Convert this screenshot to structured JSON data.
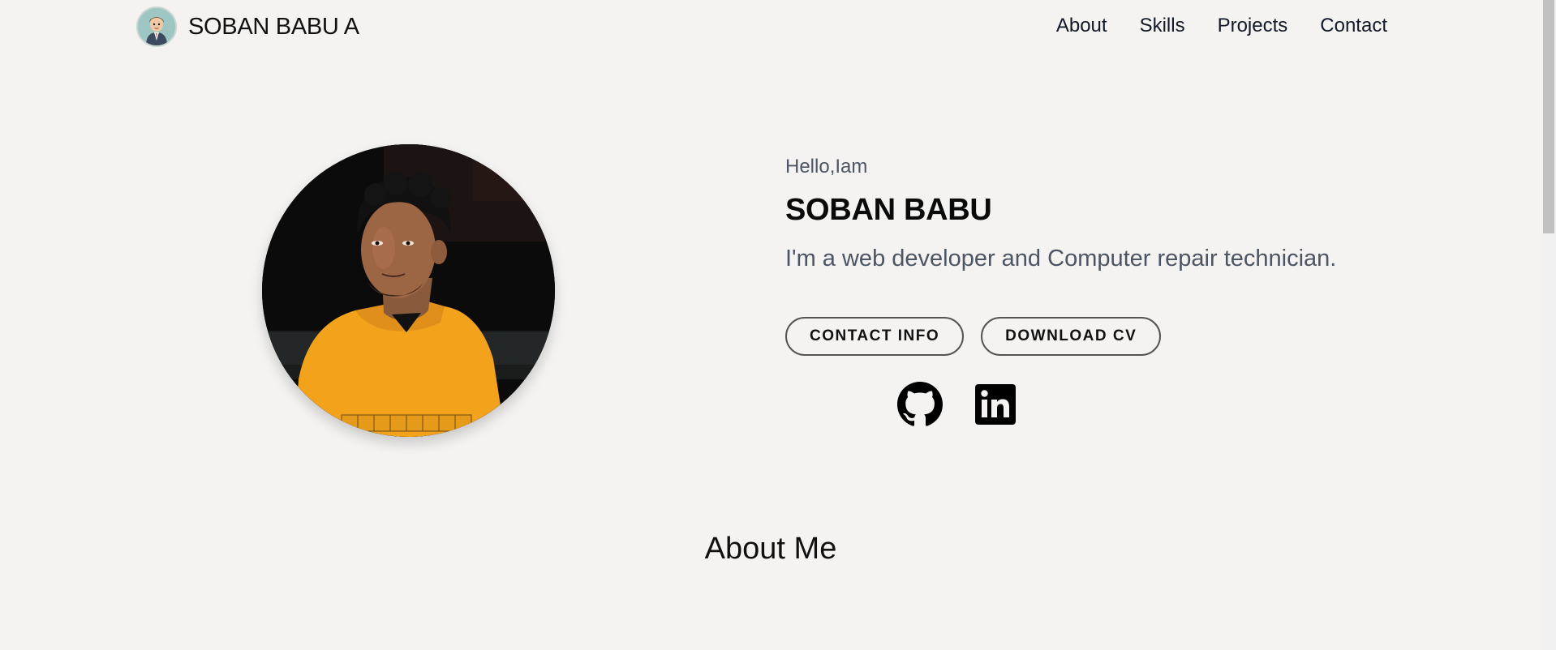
{
  "nav": {
    "brand": "SOBAN BABU A",
    "links": [
      "About",
      "Skills",
      "Projects",
      "Contact"
    ]
  },
  "hero": {
    "greeting": "Hello,Iam",
    "name": "SOBAN BABU",
    "description": "I'm a web developer and Computer repair technician.",
    "buttons": {
      "contact": "CONTACT INFO",
      "download": "DOWNLOAD CV"
    },
    "socials": [
      "github-icon",
      "linkedin-icon"
    ]
  },
  "about": {
    "title": "About Me"
  },
  "colors": {
    "background": "#f4f3f2",
    "hoodie": "#f2a31b",
    "muted_text": "#4b5563"
  }
}
